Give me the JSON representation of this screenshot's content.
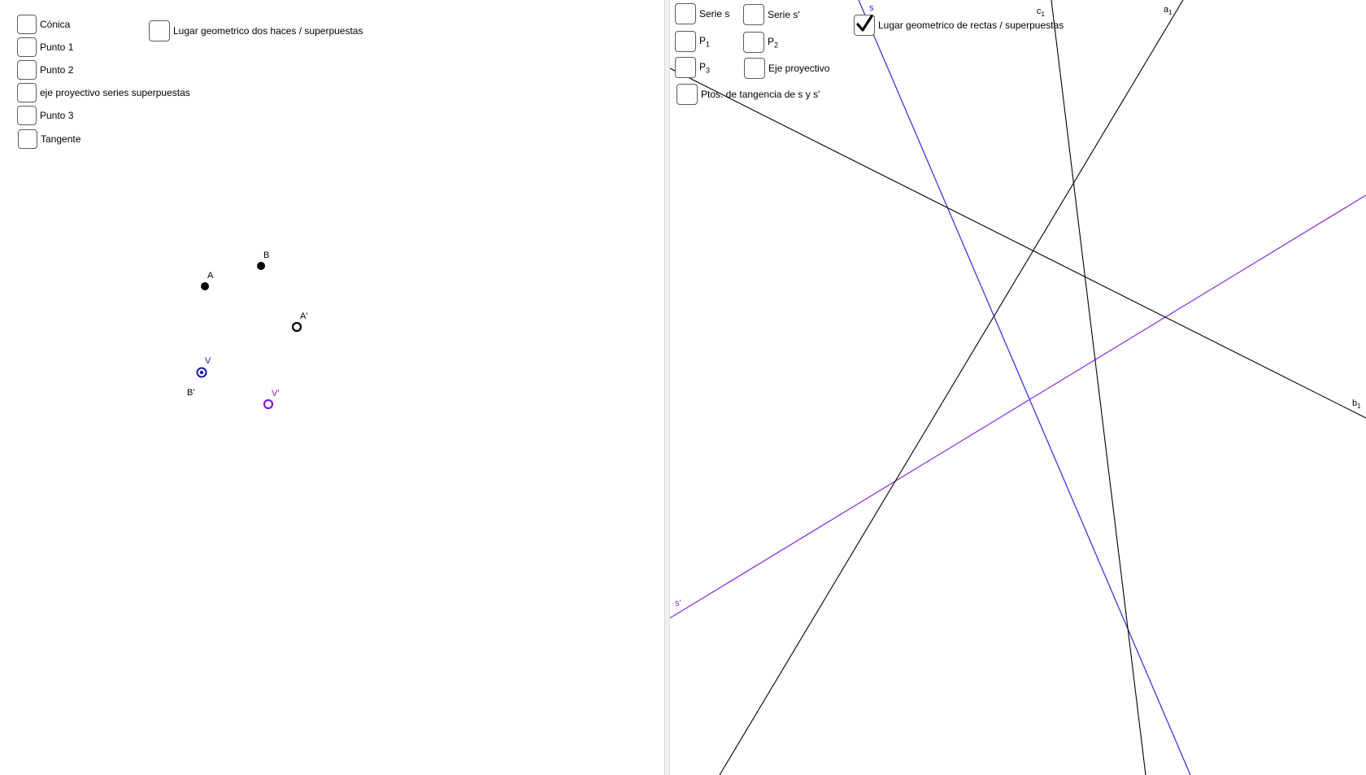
{
  "left": {
    "checkboxes": [
      {
        "label": "Cónica",
        "checked": false
      },
      {
        "label": "Punto 1",
        "checked": false
      },
      {
        "label": "Punto 2",
        "checked": false
      },
      {
        "label": "eje proyectivo series superpuestas",
        "checked": false
      },
      {
        "label": "Punto 3",
        "checked": false
      },
      {
        "label": "Tangente",
        "checked": false
      },
      {
        "label": "Lugar geometrico dos haces / superpuestas",
        "checked": false
      }
    ],
    "points": [
      {
        "label": "A",
        "style": "filled",
        "color": "#000000"
      },
      {
        "label": "B",
        "style": "filled",
        "color": "#000000"
      },
      {
        "label": "A'",
        "style": "hollow",
        "color": "#000000"
      },
      {
        "label": "V",
        "style": "ring-dot",
        "color": "#1a1aa6"
      },
      {
        "label": "B'",
        "style": "label-only",
        "color": "#000000"
      },
      {
        "label": "V'",
        "style": "hollow",
        "color": "#8b1ad6"
      }
    ]
  },
  "right": {
    "checkboxes": [
      {
        "label": "Serie s",
        "checked": false
      },
      {
        "label": "Serie s'",
        "checked": false
      },
      {
        "label": "P",
        "sub": "1",
        "checked": false
      },
      {
        "label": "P",
        "sub": "2",
        "checked": false
      },
      {
        "label": "P",
        "sub": "3",
        "checked": false
      },
      {
        "label": "Eje proyectivo",
        "checked": false
      },
      {
        "label": "Ptos. de tangencia de s y s'",
        "checked": false
      },
      {
        "label": "Lugar geometrico de rectas / superpuestas",
        "checked": true
      }
    ],
    "lines": [
      {
        "label": "s",
        "sub": "",
        "color": "#2a2ae0"
      },
      {
        "label": "s'",
        "sub": "",
        "color": "#8a2be2"
      },
      {
        "label": "a",
        "sub": "1",
        "color": "#000000"
      },
      {
        "label": "b",
        "sub": "1",
        "color": "#000000"
      },
      {
        "label": "c",
        "sub": "1",
        "color": "#000000"
      }
    ]
  },
  "colors": {
    "checkbox_border": "#5b5b5b",
    "divider": "#f1f1f1",
    "line_s": "#2a2ae0",
    "line_s_prime": "#8a2be2",
    "v_point": "#1a1aa6",
    "v_prime_point": "#8b1ad6"
  }
}
